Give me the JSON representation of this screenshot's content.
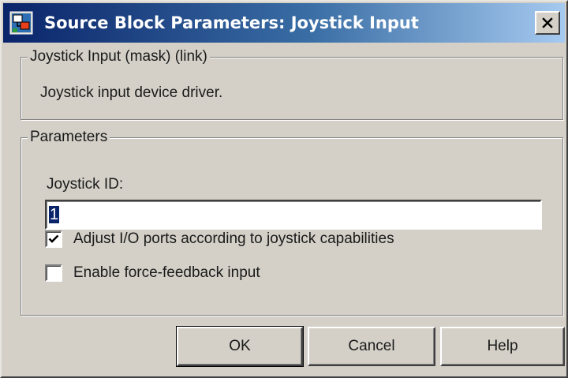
{
  "window": {
    "title": "Source Block Parameters: Joystick Input",
    "close_glyph": "X"
  },
  "description_group": {
    "title": "Joystick Input (mask) (link)",
    "text": "Joystick input device driver."
  },
  "parameters_group": {
    "title": "Parameters",
    "joystick_id": {
      "label": "Joystick ID:",
      "value": "1"
    },
    "checkboxes": [
      {
        "label": "Adjust I/O ports according to joystick capabilities",
        "checked": true
      },
      {
        "label": "Enable force-feedback input",
        "checked": false
      }
    ]
  },
  "buttons": {
    "ok": "OK",
    "cancel": "Cancel",
    "help": "Help"
  },
  "icons": {
    "app": "simulink-block-icon",
    "close": "close-icon",
    "check": "checkmark-icon"
  },
  "colors": {
    "titlebar_start": "#0a246a",
    "titlebar_end": "#a6caf0",
    "face": "#d4d0c8",
    "selection": "#0a246a"
  }
}
